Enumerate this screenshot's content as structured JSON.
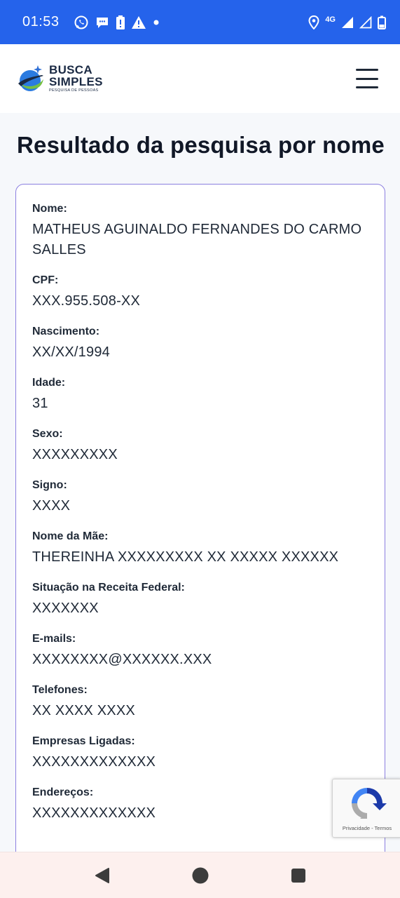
{
  "status_bar": {
    "time": "01:53",
    "network": "4G",
    "icons_left": [
      "whatsapp-icon",
      "chat-bubble-icon",
      "battery-alert-icon",
      "warning-icon",
      "dot-icon"
    ],
    "icons_right": [
      "location-icon",
      "4g-icon",
      "signal-icon",
      "signal-empty-icon",
      "battery-icon"
    ],
    "color": "#2563eb"
  },
  "header": {
    "logo_line1": "BUSCA",
    "logo_line2": "SIMPLES",
    "logo_tagline": "PESQUISA DE PESSOAS",
    "menu_icon": "hamburger-menu-icon"
  },
  "page": {
    "title": "Resultado da pesquisa por nome"
  },
  "result": {
    "fields": [
      {
        "label": "Nome:",
        "value": "MATHEUS AGUINALDO FERNANDES DO CARMO SALLES"
      },
      {
        "label": "CPF:",
        "value": "XXX.955.508-XX"
      },
      {
        "label": "Nascimento:",
        "value": "XX/XX/1994"
      },
      {
        "label": "Idade:",
        "value": "31"
      },
      {
        "label": "Sexo:",
        "value": "XXXXXXXXX"
      },
      {
        "label": "Signo:",
        "value": "XXXX"
      },
      {
        "label": "Nome da Mãe:",
        "value": "THEREINHA XXXXXXXXX XX XXXXX XXXXXX"
      },
      {
        "label": "Situação na Receita Federal:",
        "value": "XXXXXXX"
      },
      {
        "label": "E-mails:",
        "value": "XXXXXXXX@XXXXXX.XXX"
      },
      {
        "label": "Telefones:",
        "value": "XX XXXX XXXX"
      },
      {
        "label": "Empresas Ligadas:",
        "value": "XXXXXXXXXXXXX"
      },
      {
        "label": "Endereços:",
        "value": "XXXXXXXXXXXXX"
      }
    ]
  },
  "recaptcha": {
    "links": "Privacidade - Termos"
  },
  "navigation": {
    "buttons": [
      "back-icon",
      "home-icon",
      "recents-icon"
    ]
  }
}
